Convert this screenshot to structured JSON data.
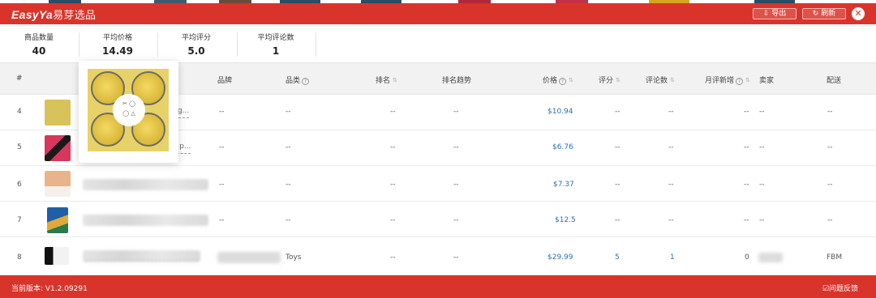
{
  "header": {
    "logo": "EasyYa",
    "logo_cn": "易芽选品",
    "export_label": "⇩ 导出",
    "refresh_label": "↻ 刷新",
    "close_glyph": "✕"
  },
  "stats": [
    {
      "label": "商品数量",
      "value": "40"
    },
    {
      "label": "平均价格",
      "value": "14.49"
    },
    {
      "label": "平均评分",
      "value": "5.0"
    },
    {
      "label": "平均评论数",
      "value": "1"
    }
  ],
  "table": {
    "columns": {
      "index": "#",
      "brand": "品牌",
      "category": "品类",
      "rank": "排名",
      "rank_trend": "排名趋势",
      "price": "价格",
      "rating": "评分",
      "reviews": "评论数",
      "monthly_new_reviews": "月评新增",
      "seller": "卖家",
      "delivery": "配送"
    },
    "help_glyph": "?",
    "sort_glyph": "⇅",
    "rows": [
      {
        "index": "4",
        "title_fragment": "s Sug...",
        "brand": "--",
        "category": "--",
        "rank": "--",
        "rank_trend": "--",
        "price": "$10.94",
        "rating": "--",
        "reviews": "--",
        "monthly_new": "--",
        "seller": "--",
        "delivery": "--"
      },
      {
        "index": "5",
        "title_fragment": "me p...",
        "brand": "--",
        "category": "--",
        "rank": "--",
        "rank_trend": "--",
        "price": "$6.76",
        "rating": "--",
        "reviews": "--",
        "monthly_new": "--",
        "seller": "--",
        "delivery": "--"
      },
      {
        "index": "6",
        "title_fragment": "",
        "brand": "--",
        "category": "--",
        "rank": "--",
        "rank_trend": "--",
        "price": "$7.37",
        "rating": "--",
        "reviews": "--",
        "monthly_new": "--",
        "seller": "--",
        "delivery": "--"
      },
      {
        "index": "7",
        "title_fragment": "",
        "brand": "--",
        "category": "--",
        "rank": "--",
        "rank_trend": "--",
        "price": "$12.5",
        "rating": "--",
        "reviews": "--",
        "monthly_new": "--",
        "seller": "--",
        "delivery": "--"
      },
      {
        "index": "8",
        "title_fragment": "",
        "brand": "",
        "category": "Toys",
        "rank": "--",
        "rank_trend": "--",
        "price": "$29.99",
        "rating": "5",
        "reviews": "1",
        "monthly_new": "0",
        "seller": "",
        "delivery": "FBM"
      }
    ]
  },
  "footer": {
    "version": "当前版本: V1.2.09291",
    "feedback": "☑问题反馈"
  },
  "colors": {
    "brand_red": "#d9342b",
    "link_blue": "#2c6fb0"
  }
}
